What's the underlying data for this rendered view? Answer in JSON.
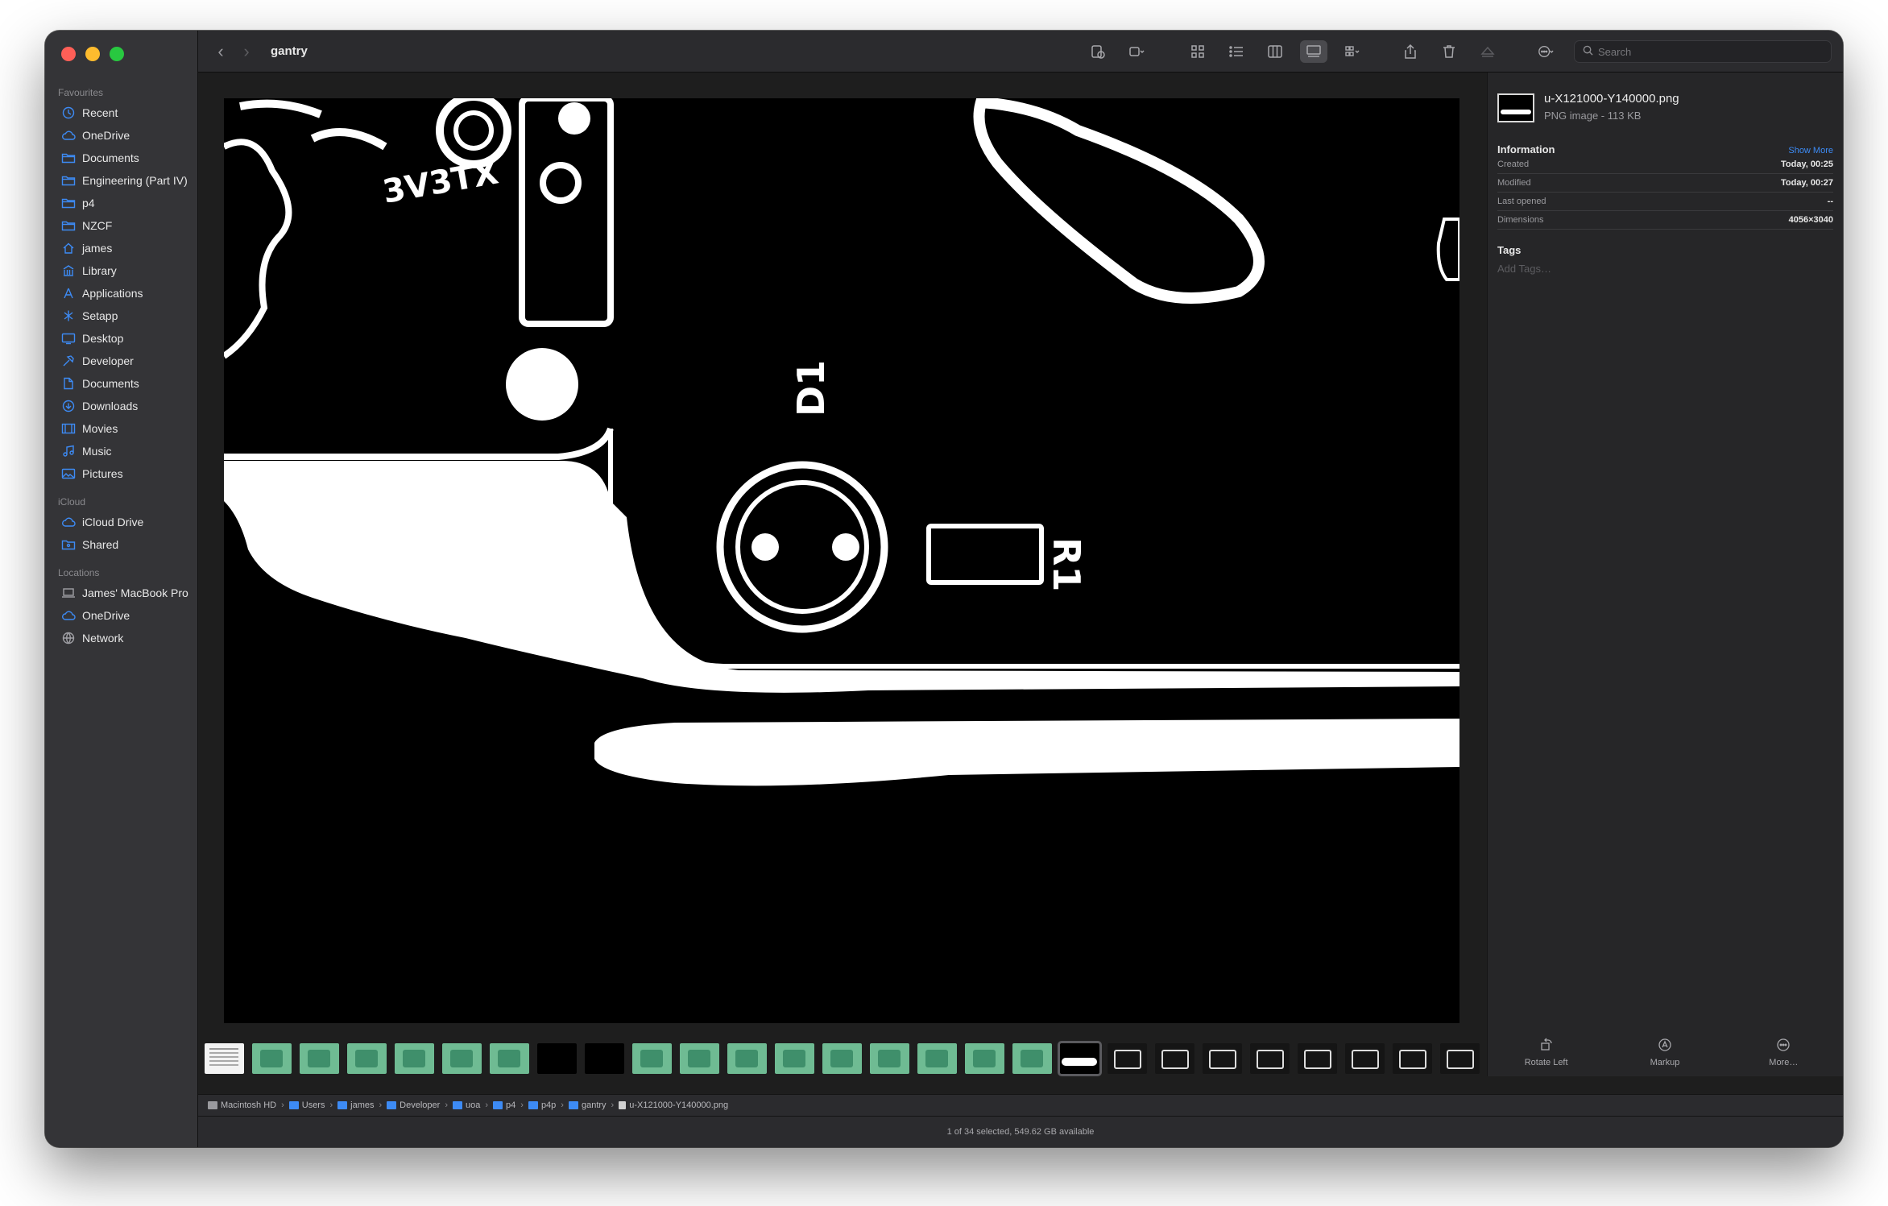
{
  "window": {
    "title": "gantry"
  },
  "sidebar": {
    "sections": [
      {
        "title": "Favourites",
        "items": [
          {
            "label": "Recent",
            "icon": "clock-icon"
          },
          {
            "label": "OneDrive",
            "icon": "cloud-icon"
          },
          {
            "label": "Documents",
            "icon": "folder-icon"
          },
          {
            "label": "Engineering (Part IV)",
            "icon": "folder-icon"
          },
          {
            "label": "p4",
            "icon": "folder-icon"
          },
          {
            "label": "NZCF",
            "icon": "folder-icon"
          },
          {
            "label": "james",
            "icon": "home-icon"
          },
          {
            "label": "Library",
            "icon": "library-icon"
          },
          {
            "label": "Applications",
            "icon": "applications-icon"
          },
          {
            "label": "Setapp",
            "icon": "setapp-icon"
          },
          {
            "label": "Desktop",
            "icon": "desktop-icon"
          },
          {
            "label": "Developer",
            "icon": "hammer-icon"
          },
          {
            "label": "Documents",
            "icon": "document-icon"
          },
          {
            "label": "Downloads",
            "icon": "download-icon"
          },
          {
            "label": "Movies",
            "icon": "film-icon"
          },
          {
            "label": "Music",
            "icon": "music-icon"
          },
          {
            "label": "Pictures",
            "icon": "photo-icon"
          }
        ]
      },
      {
        "title": "iCloud",
        "items": [
          {
            "label": "iCloud Drive",
            "icon": "cloud-icon"
          },
          {
            "label": "Shared",
            "icon": "shared-folder-icon"
          }
        ]
      },
      {
        "title": "Locations",
        "items": [
          {
            "label": "James' MacBook Pro",
            "icon": "laptop-icon"
          },
          {
            "label": "OneDrive",
            "icon": "cloud-icon"
          },
          {
            "label": "Network",
            "icon": "globe-icon"
          }
        ]
      }
    ]
  },
  "toolbar": {
    "back": "‹",
    "forward": "›",
    "search_placeholder": "Search"
  },
  "inspector": {
    "file_name": "u-X121000-Y140000.png",
    "file_type": "PNG image - 113 KB",
    "information_title": "Information",
    "show_more": "Show More",
    "rows": [
      {
        "key": "Created",
        "value": "Today, 00:25"
      },
      {
        "key": "Modified",
        "value": "Today, 00:27"
      },
      {
        "key": "Last opened",
        "value": "--"
      },
      {
        "key": "Dimensions",
        "value": "4056×3040"
      }
    ],
    "tags_title": "Tags",
    "tags_placeholder": "Add Tags…"
  },
  "quick_actions": [
    {
      "label": "Rotate Left",
      "icon": "rotate-left-icon"
    },
    {
      "label": "Markup",
      "icon": "markup-icon"
    },
    {
      "label": "More…",
      "icon": "ellipsis-icon"
    }
  ],
  "preview": {
    "silkscreen": [
      "D1",
      "R1",
      "3V3TX"
    ]
  },
  "thumbnails": [
    "doc",
    "green",
    "green",
    "green",
    "green",
    "green",
    "green",
    "black",
    "black",
    "green",
    "green",
    "green",
    "green",
    "green",
    "green",
    "green",
    "green",
    "green",
    "selected",
    "bw",
    "bw",
    "bw",
    "bw",
    "bw",
    "bw",
    "bw",
    "bw"
  ],
  "pathbar": [
    "Macintosh HD",
    "Users",
    "james",
    "Developer",
    "uoa",
    "p4",
    "p4p",
    "gantry",
    "u-X121000-Y140000.png"
  ],
  "status": "1 of 34 selected, 549.62 GB available",
  "colors": {
    "accent": "#3d8bf5",
    "window_bg": "#1e1e1e",
    "sidebar_bg": "#343437"
  }
}
